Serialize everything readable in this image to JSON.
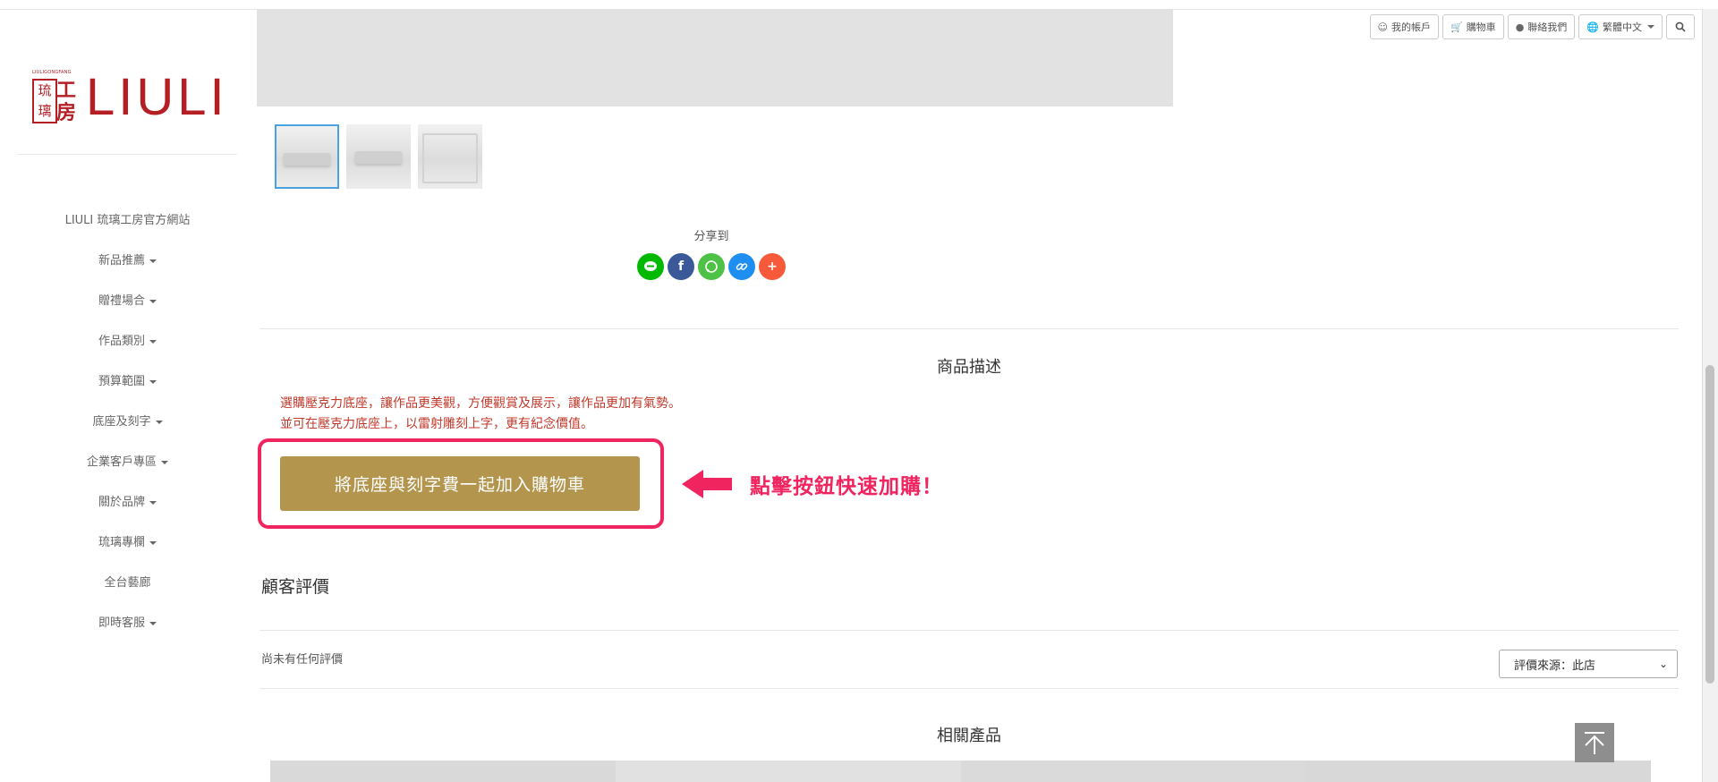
{
  "brand": {
    "logo_small_text": "LIULIGONGFANG",
    "logo_seal_chars": [
      "琉",
      "璃"
    ],
    "logo_seal_chars_2": [
      "工",
      "房"
    ],
    "logo_text": "LIULI"
  },
  "toolbar": {
    "account": "我的帳戶",
    "cart": "購物車",
    "contact": "聯絡我們",
    "language": "繁體中文"
  },
  "sidebar": {
    "items": [
      {
        "label": "LIULI 琉璃工房官方網站",
        "has_caret": false
      },
      {
        "label": "新品推薦",
        "has_caret": true
      },
      {
        "label": "贈禮場合",
        "has_caret": true
      },
      {
        "label": "作品類別",
        "has_caret": true
      },
      {
        "label": "預算範圍",
        "has_caret": true
      },
      {
        "label": "底座及刻字",
        "has_caret": true
      },
      {
        "label": "企業客戶專區",
        "has_caret": true
      },
      {
        "label": "關於品牌",
        "has_caret": true
      },
      {
        "label": "琉璃專欄",
        "has_caret": true
      },
      {
        "label": "全台藝廊",
        "has_caret": false
      },
      {
        "label": "即時客服",
        "has_caret": true
      }
    ]
  },
  "share": {
    "label": "分享到",
    "icons": [
      {
        "name": "line",
        "color": "#00b900"
      },
      {
        "name": "facebook",
        "color": "#3b5998"
      },
      {
        "name": "whatsapp",
        "color": "#4dc247"
      },
      {
        "name": "link",
        "color": "#1f8ef1"
      },
      {
        "name": "more",
        "color": "#f65a3b"
      }
    ]
  },
  "description": {
    "title": "商品描述",
    "lines": [
      "選購壓克力底座，讓作品更美觀，方便觀賞及展示，讓作品更加有氣勢。",
      "並可在壓克力底座上，以雷射雕刻上字，更有紀念價值。"
    ],
    "cta_button": "將底座與刻字費一起加入購物車",
    "cta_hint": "點擊按鈕快速加購！"
  },
  "reviews": {
    "title": "顧客評價",
    "empty_text": "尚未有任何評價",
    "source_select": "評價來源：此店"
  },
  "related": {
    "title": "相關產品"
  },
  "colors": {
    "brand_red": "#b51f24",
    "cta_gold": "#b3954e",
    "highlight_pink": "#f0245e",
    "desc_red": "#c0392b"
  }
}
